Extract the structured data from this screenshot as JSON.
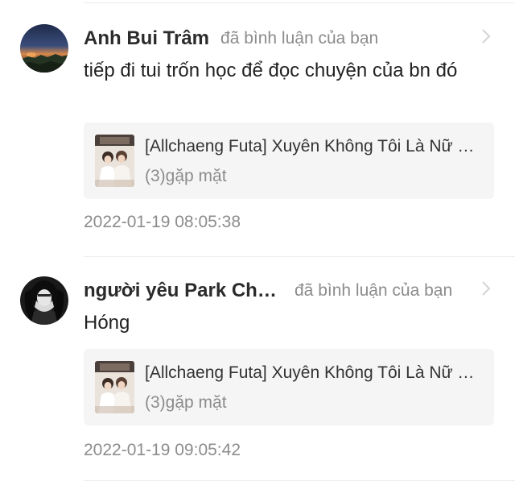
{
  "comments": [
    {
      "user_name": "Anh Bui Trâm",
      "action": "đã bình luận của bạn",
      "text": "tiếp đi tui trốn học để đọc chuyện của bn đó",
      "card": {
        "title": "[Allchaeng Futa] Xuyên Không Tôi Là Nữ Chính",
        "subtitle": "(3)gặp mặt"
      },
      "timestamp": "2022-01-19 08:05:38",
      "avatar_icon": "sunset-landscape-avatar",
      "chevron_icon": "chevron-right-icon"
    },
    {
      "user_name": "người yêu Park Chaeyoung",
      "action": "đã bình luận của bạn",
      "text": "Hóng",
      "card": {
        "title": "[Allchaeng Futa] Xuyên Không Tôi Là Nữ Chính",
        "subtitle": "(3)gặp mặt"
      },
      "timestamp": "2022-01-19 09:05:42",
      "avatar_icon": "girl-portrait-avatar",
      "chevron_icon": "chevron-right-icon"
    }
  ],
  "colors": {
    "name": "#2b2b2b",
    "muted": "#8c8c8c",
    "card_background": "#f5f5f5",
    "divider": "#ececec"
  }
}
